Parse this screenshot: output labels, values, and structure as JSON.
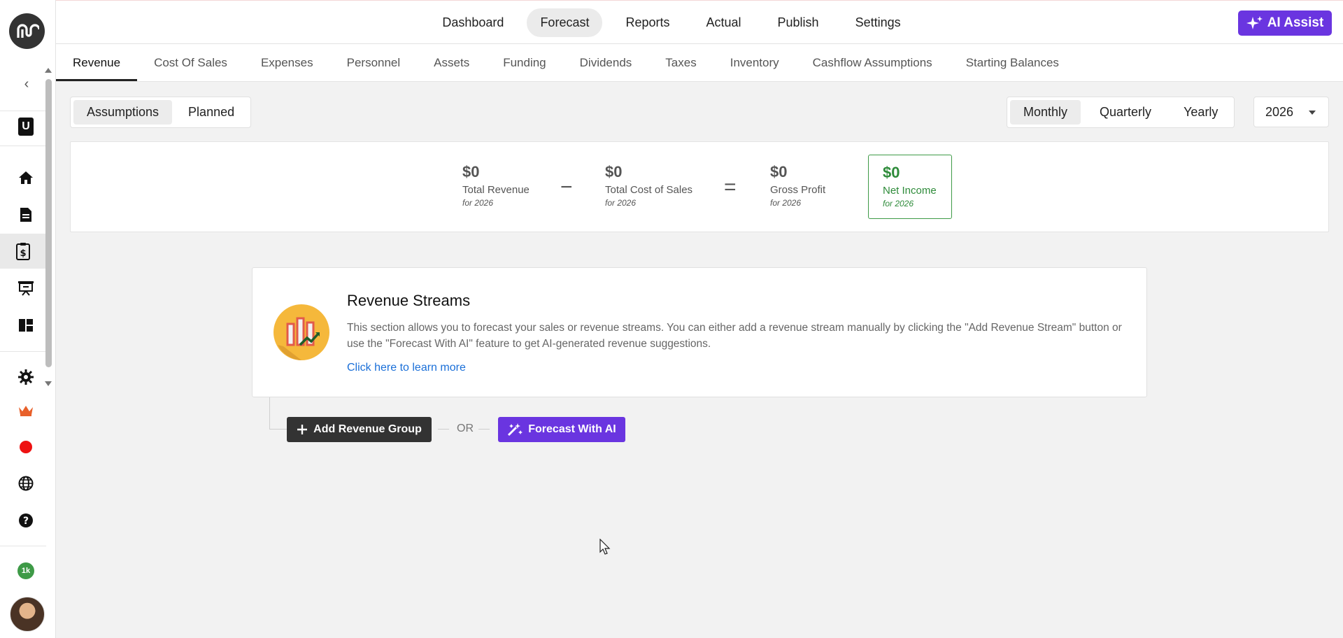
{
  "topnav": {
    "items": [
      {
        "label": "Dashboard"
      },
      {
        "label": "Forecast",
        "active": true
      },
      {
        "label": "Reports"
      },
      {
        "label": "Actual"
      },
      {
        "label": "Publish"
      },
      {
        "label": "Settings"
      }
    ],
    "ai_assist_label": "AI Assist"
  },
  "rail": {
    "workspace_letter": "U",
    "badge": "1k"
  },
  "subtabs": [
    {
      "label": "Revenue",
      "active": true
    },
    {
      "label": "Cost Of Sales"
    },
    {
      "label": "Expenses"
    },
    {
      "label": "Personnel"
    },
    {
      "label": "Assets"
    },
    {
      "label": "Funding"
    },
    {
      "label": "Dividends"
    },
    {
      "label": "Taxes"
    },
    {
      "label": "Inventory"
    },
    {
      "label": "Cashflow Assumptions"
    },
    {
      "label": "Starting Balances"
    }
  ],
  "mode_toggle": {
    "options": [
      {
        "label": "Assumptions",
        "active": true
      },
      {
        "label": "Planned"
      }
    ]
  },
  "period_toggle": {
    "options": [
      {
        "label": "Monthly",
        "active": true
      },
      {
        "label": "Quarterly"
      },
      {
        "label": "Yearly"
      }
    ]
  },
  "year": "2026",
  "summary": {
    "revenue": {
      "value": "$0",
      "label": "Total Revenue",
      "sub": "for 2026"
    },
    "cost": {
      "value": "$0",
      "label": "Total Cost of Sales",
      "sub": "for 2026"
    },
    "gross": {
      "value": "$0",
      "label": "Gross Profit",
      "sub": "for 2026"
    },
    "net": {
      "value": "$0",
      "label": "Net Income",
      "sub": "for 2026"
    },
    "minus": "−",
    "equals": "="
  },
  "streams": {
    "title": "Revenue Streams",
    "description": "This section allows you to forecast your sales or revenue streams. You can either add a revenue stream manually by clicking the \"Add Revenue Stream\" button or use the \"Forecast With AI\" feature to get AI-generated revenue suggestions.",
    "learn_more": "Click here to learn more"
  },
  "actions": {
    "add_group": "Add Revenue Group",
    "or": "OR",
    "forecast_ai": "Forecast With AI"
  },
  "colors": {
    "accent_purple": "#6a35e0",
    "success_green": "#2e8b3a",
    "link_blue": "#1a6fd8"
  }
}
